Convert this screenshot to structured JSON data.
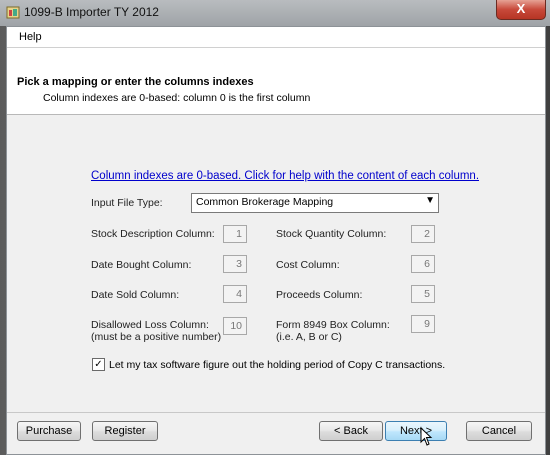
{
  "window": {
    "title": "1099-B Importer TY 2012",
    "close_symbol": "X"
  },
  "menu": {
    "help": "Help"
  },
  "header": {
    "title": "Pick a mapping or enter the columns indexes",
    "subtitle": "Column indexes are 0-based: column 0 is the first column"
  },
  "help_link": "Column indexes are 0-based. Click for help with the content of each column.",
  "input_file_type": {
    "label": "Input File Type:",
    "value": "Common Brokerage Mapping"
  },
  "columns": {
    "stock_description": {
      "label": "Stock Description Column:",
      "value": "1"
    },
    "date_bought": {
      "label": "Date Bought Column:",
      "value": "3"
    },
    "date_sold": {
      "label": "Date Sold Column:",
      "value": "4"
    },
    "disallowed_loss": {
      "label_line1": "Disallowed Loss Column:",
      "label_line2": "(must be a positive number)",
      "value": "10"
    },
    "stock_quantity": {
      "label": "Stock Quantity Column:",
      "value": "2"
    },
    "cost": {
      "label": "Cost Column:",
      "value": "6"
    },
    "proceeds": {
      "label": "Proceeds Column:",
      "value": "5"
    },
    "form_8949_box": {
      "label_line1": "Form 8949 Box Column:",
      "label_line2": "(i.e. A, B or C)",
      "value": "9"
    }
  },
  "copy_c_option": {
    "checked": true,
    "check_mark": "✓",
    "label": "Let my tax software figure out the holding period of Copy C transactions."
  },
  "buttons": {
    "purchase": "Purchase",
    "register": "Register",
    "back": "< Back",
    "next": "Next >",
    "cancel": "Cancel"
  }
}
